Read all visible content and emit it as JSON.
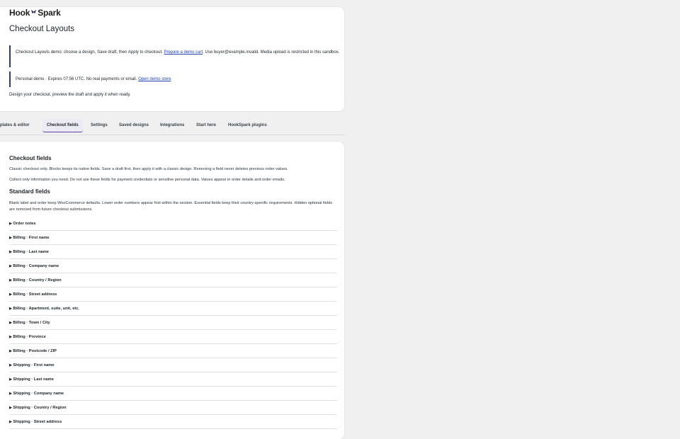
{
  "brand": {
    "name_part1": "Hook",
    "name_part2": "Spark",
    "logo_icon": "spark-icon"
  },
  "page": {
    "title": "Checkout Layouts"
  },
  "notices": {
    "demo": {
      "text_before": "Checkout Layouts demo: choose a design, Save draft, then Apply to checkout.",
      "link": "Prepare a demo cart",
      "text_after": ". Use buyer@example.invalid. Media upload is restricted in this sandbox."
    },
    "personal": {
      "text": "Personal demo · Expires 07:56 UTC. No real payments or email.",
      "link": "Open demo store"
    }
  },
  "intro": "Design your checkout, preview the draft and apply it when ready.",
  "tabs": [
    {
      "label": "Templates & editor",
      "active": false
    },
    {
      "label": "Checkout fields",
      "active": true
    },
    {
      "label": "Settings",
      "active": false
    },
    {
      "label": "Saved designs",
      "active": false
    },
    {
      "label": "Integrations",
      "active": false
    },
    {
      "label": "Start here",
      "active": false
    },
    {
      "label": "HookSpark plugins",
      "active": false
    }
  ],
  "checkout_fields": {
    "title": "Checkout fields",
    "para1": "Classic checkout only. Blocks keeps its native fields. Save a draft first, then apply it with a classic design. Removing a field never deletes previous order values.",
    "para2": "Collect only information you need. Do not use these fields for payment credentials or sensitive personal data. Values appear in order details and order emails."
  },
  "standard_fields": {
    "title": "Standard fields",
    "description": "Blank label and order keep WooCommerce defaults. Lower order numbers appear first within the section. Essential fields keep their country-specific requirements. Hidden optional fields are removed from future checkout submissions.",
    "items": [
      "Order notes",
      "Billing · First name",
      "Billing · Last name",
      "Billing · Company name",
      "Billing · Country / Region",
      "Billing · Street address",
      "Billing · Apartment, suite, unit, etc.",
      "Billing · Town / City",
      "Billing · Province",
      "Billing · Postcode / ZIP",
      "Shipping · First name",
      "Shipping · Last name",
      "Shipping · Company name",
      "Shipping · Country / Region",
      "Shipping · Street address"
    ]
  }
}
